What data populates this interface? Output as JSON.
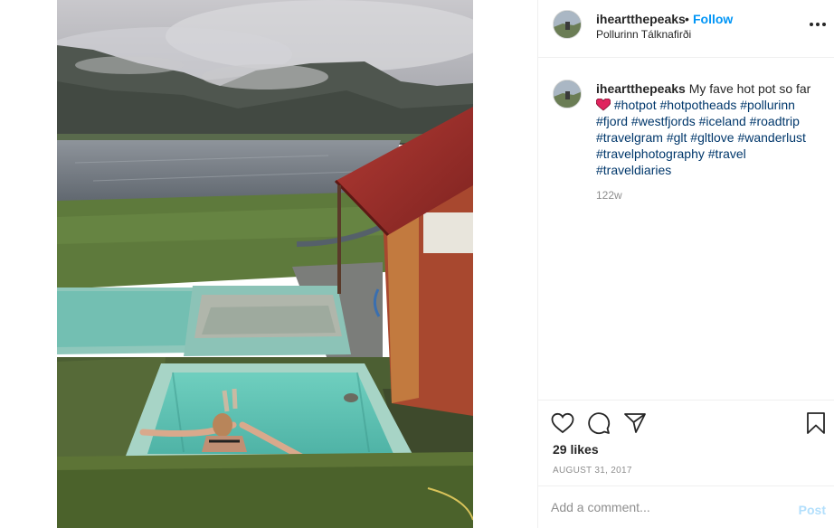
{
  "post": {
    "image_alt": "Woman relaxing in a hot pot by a fjord",
    "username": "iheartthepeaks",
    "separator": "•",
    "follow_label": "Follow",
    "location": "Pollurinn Tálknafirði"
  },
  "caption": {
    "username": "iheartthepeaks",
    "text": "My fave hot pot so far",
    "emoji": "heart-emoji",
    "hashtags": [
      "#hotpot",
      "#hotpotheads",
      "#pollurinn",
      "#fjord",
      "#westfjords",
      "#iceland",
      "#roadtrip",
      "#travelgram",
      "#glt",
      "#gltlove",
      "#wanderlust",
      "#travelphotography",
      "#travel",
      "#traveldiaries"
    ],
    "time": "122w"
  },
  "actions": {
    "like_icon": "heart-outline-icon",
    "comment_icon": "comment-icon",
    "share_icon": "share-icon",
    "save_icon": "bookmark-icon",
    "likes": "29 likes",
    "date": "AUGUST 31, 2017"
  },
  "comment_bar": {
    "placeholder": "Add a comment...",
    "post_label": "Post"
  },
  "colors": {
    "follow": "#0095f6",
    "hashtag": "#00376b",
    "muted": "#8e8e8e",
    "post_disabled": "#b2dffc",
    "emoji_heart": "#e0245e"
  }
}
